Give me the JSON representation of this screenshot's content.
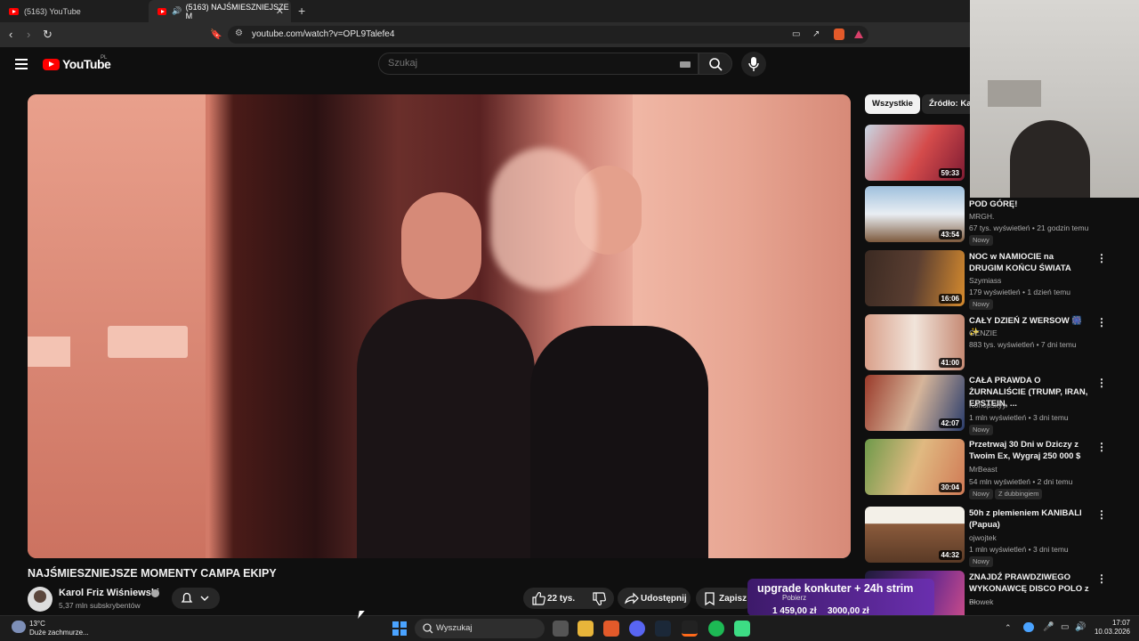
{
  "browser": {
    "tabs": [
      {
        "label": "(5163) YouTube"
      },
      {
        "label": "(5163) NAJŚMIESZNIEJSZE M"
      }
    ],
    "url": "youtube.com/watch?v=OPL9Talefe4"
  },
  "youtube": {
    "logo_text": "YouTube",
    "country_code": "PL",
    "search_placeholder": "Szukaj"
  },
  "video": {
    "title": "NAJŚMIESZNIEJSZE MOMENTY CAMPA EKIPY",
    "channel": "Karol Friz Wiśniewski",
    "subscribers": "5,37 mln subskrybentów",
    "likes": "22 tys.",
    "share_label": "Udostępnij",
    "save_label": "Zapisz"
  },
  "sidebar": {
    "chips": [
      "Wszystkie",
      "Źródło: Karol"
    ],
    "items": [
      {
        "title": "",
        "channel": "",
        "views": "",
        "duration": "59:33",
        "badge": "",
        "thumb_color": "#b3263a"
      },
      {
        "title": "POD GÓRĘ!",
        "channel": "MRGH.",
        "views": "67 tys. wyświetleń • 21 godzin temu",
        "duration": "43:54",
        "badge": "Nowy",
        "thumb_color": "#7aa6c9"
      },
      {
        "title": "NOC w NAMIOCIE na DRUGIM KOŃCU ŚWIATA",
        "channel": "Szymiass",
        "views": "179 wyświetleń • 1 dzień temu",
        "duration": "16:06",
        "badge": "Nowy",
        "thumb_color": "#3a2f2a"
      },
      {
        "title": "CAŁY DZIEŃ Z WERSOW 🎆✨",
        "channel": "GENZIE",
        "views": "883 tys. wyświetleń • 7 dni temu",
        "duration": "41:00",
        "badge": "",
        "thumb_color": "#c98f7a"
      },
      {
        "title": "CAŁA PRAWDA O ŻURNALIŚCIE (TRUMP, IRAN, EPSTEIN, ...",
        "channel": "Konopskyy",
        "views": "1 mln wyświetleń • 3 dni temu",
        "duration": "42:07",
        "badge": "Nowy",
        "thumb_color": "#8a3b2c"
      },
      {
        "title": "Przetrwaj 30 Dni w Dziczy z Twoim Ex, Wygraj 250 000 $",
        "channel": "MrBeast",
        "views": "54 mln wyświetleń • 2 dni temu",
        "duration": "30:04",
        "badge": "Nowy",
        "badge2": "Z dubbingiem",
        "thumb_color": "#d5a46a"
      },
      {
        "title": "50h z plemieniem KANIBALI (Papua)",
        "channel": "ojwojtek",
        "views": "1 mln wyświetleń • 3 dni temu",
        "duration": "44:32",
        "badge": "Nowy",
        "thumb_color": "#6e4a32"
      },
      {
        "title": "ZNAJDŹ PRAWDZIWEGO WYKONAWCĘ DISCO POLO z ...",
        "channel": "Blowek",
        "views": "",
        "duration": "",
        "badge": "",
        "thumb_color": "#4b2a6b"
      }
    ]
  },
  "stream_overlay": {
    "label": "upgrade konkuter + 24h strim",
    "download": "Pobierz",
    "amount_current": "1 459,00 zł",
    "amount_goal": "3000,00 zł"
  },
  "taskbar": {
    "weather_temp": "13°C",
    "weather_desc": "Duże zachmurze...",
    "search_label": "Wyszukaj",
    "time": "17:07",
    "date": "10.03.2026"
  },
  "colors": {
    "youtube_red": "#ff0000",
    "background": "#0f0f0f",
    "taskbar": "#1c1c1c"
  }
}
